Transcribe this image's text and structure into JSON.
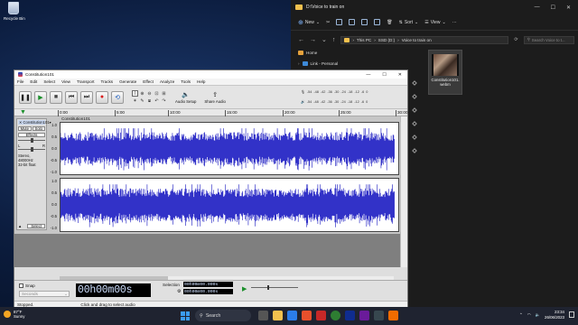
{
  "desktop": {
    "recycle_bin_label": "Recycle Bin"
  },
  "explorer": {
    "title": "D:\\Voice to train on",
    "toolbar": {
      "new_label": "New",
      "sort_label": "Sort",
      "view_label": "View"
    },
    "breadcrumb": [
      "This PC",
      "SSD (D:)",
      "Voice to train on"
    ],
    "search_placeholder": "Search Voice to t...",
    "nav_items": [
      {
        "label": "Home"
      },
      {
        "label": "Link - Personal"
      }
    ],
    "file": {
      "name_line1": "Constitution101.",
      "name_line2": "webm"
    }
  },
  "audacity": {
    "title": "Constitution101",
    "menu": [
      "File",
      "Edit",
      "Select",
      "View",
      "Transport",
      "Tracks",
      "Generate",
      "Effect",
      "Analyze",
      "Tools",
      "Help"
    ],
    "audio_setup_label": "Audio Setup",
    "share_audio_label": "Share Audio",
    "meter_ticks": [
      "-54",
      "-48",
      "-42",
      "-36",
      "-30",
      "-24",
      "-18",
      "-12",
      "-6",
      "0"
    ],
    "ruler_ticks": [
      "0:00",
      "5:00",
      "10:00",
      "15:00",
      "20:00",
      "25:00",
      "30:00"
    ],
    "track": {
      "name": "Constitution101",
      "clip_name": "Constitution101",
      "mute_label": "Mute",
      "solo_label": "Solo",
      "effects_label": "Effects",
      "pan_left": "L",
      "pan_right": "R",
      "info_line1": "Stereo, 48000Hz",
      "info_line2": "32-bit float",
      "select_label": "Select",
      "scale_labels": [
        "1.0",
        "0.5",
        "0.0",
        "-0.5",
        "-1.0"
      ]
    },
    "snap_label": "Snap",
    "snap_value": "Seconds",
    "time_display": "00h00m00s",
    "selection_label": "Selection",
    "selection_start": "00h00m00.000s",
    "selection_end": "00h00m00.000s",
    "status_left": "Stopped.",
    "status_hint": "Click and drag to select audio"
  },
  "taskbar": {
    "weather_temp": "87°F",
    "weather_desc": "Sunny",
    "search_label": "Search",
    "clock_time": "23:34",
    "clock_date": "26/06/2023"
  },
  "colors": {
    "waveform": "#3232c8",
    "explorer_bg": "#1c1c1c",
    "taskbar_bg": "#1f2330"
  }
}
